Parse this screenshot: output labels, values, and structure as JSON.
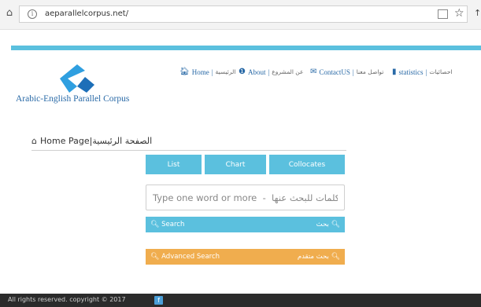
{
  "browser": {
    "url": "aeparallelcorpus.net/",
    "home_icon": "home-icon",
    "info_icon": "info-icon",
    "reader_icon": "reader-view-icon",
    "favorite_icon": "star-icon"
  },
  "site": {
    "title": "Arabic-English Parallel Corpus",
    "brand_color": "#5bc0de"
  },
  "nav": {
    "home_en": "Home",
    "home_ar": "الرئيسية",
    "about_en": "About",
    "about_ar": "عن المشروع",
    "contact_en": "ContactUS",
    "contact_ar": "تواصل معنا",
    "stats_en": "statistics",
    "stats_ar": "احصائيات"
  },
  "breadcrumb": {
    "label": "Home Page|الصفحة الرئيسية"
  },
  "tabs": {
    "list": "List",
    "chart": "Chart",
    "collocates": "Collocates"
  },
  "search": {
    "placeholder": "Type one word or more  -  اكتب كلمات للبحث عنها",
    "search_en": "Search",
    "search_ar": "بحث",
    "advanced_en": "Advanced Search",
    "advanced_ar": "بحث متقدم"
  },
  "colors": {
    "primary": "#5bc0de",
    "warning": "#f0ad4e",
    "footer_bg": "#2b2b2b",
    "link": "#2a6aa7"
  },
  "footer": {
    "copyright": "All rights reserved. copyright © 2017"
  }
}
